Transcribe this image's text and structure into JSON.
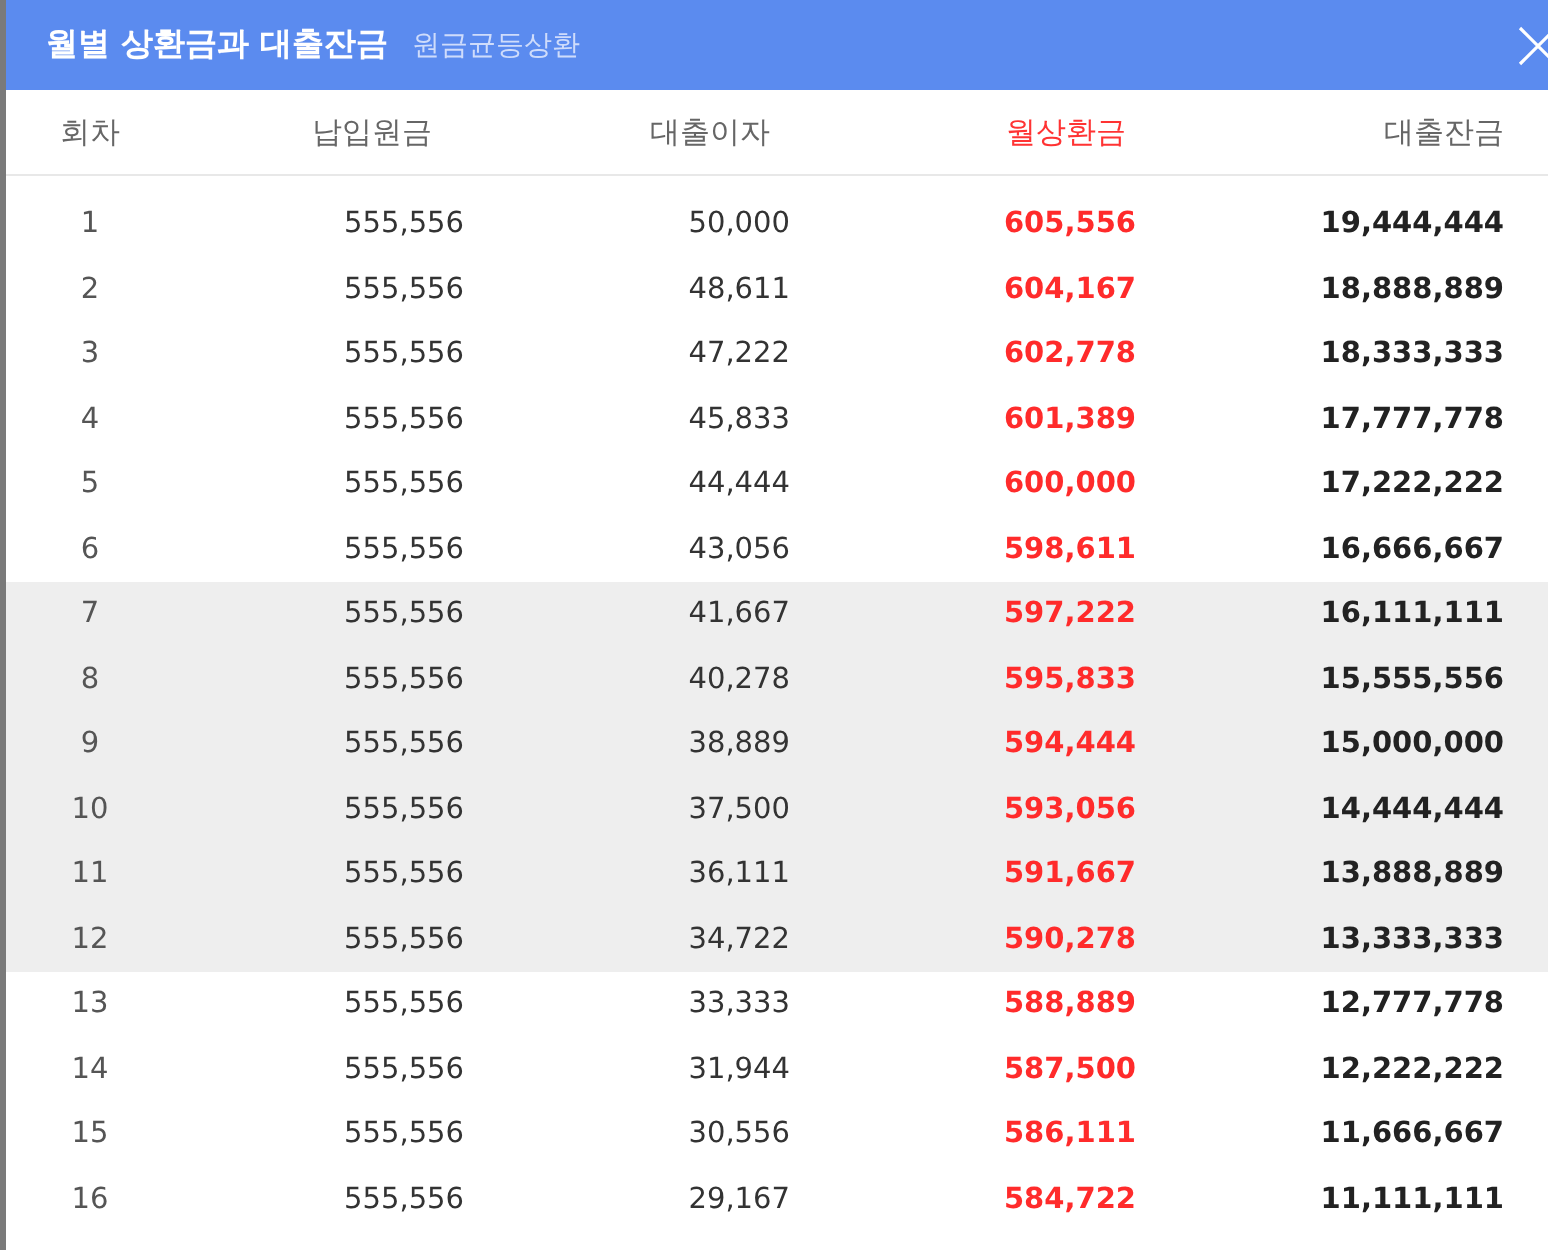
{
  "window": {
    "title": "월별 상환금과 대출잔금",
    "subtitle": "원금균등상환"
  },
  "table": {
    "columns": [
      {
        "label": "회차",
        "highlight": false
      },
      {
        "label": "납입원금",
        "highlight": false
      },
      {
        "label": "대출이자",
        "highlight": false
      },
      {
        "label": "월상환금",
        "highlight": true
      },
      {
        "label": "대출잔금",
        "highlight": false
      }
    ],
    "rows": [
      {
        "cells": [
          "1",
          "555,556",
          "50,000",
          "605,556",
          "19,444,444"
        ],
        "shaded": false
      },
      {
        "cells": [
          "2",
          "555,556",
          "48,611",
          "604,167",
          "18,888,889"
        ],
        "shaded": false
      },
      {
        "cells": [
          "3",
          "555,556",
          "47,222",
          "602,778",
          "18,333,333"
        ],
        "shaded": false
      },
      {
        "cells": [
          "4",
          "555,556",
          "45,833",
          "601,389",
          "17,777,778"
        ],
        "shaded": false
      },
      {
        "cells": [
          "5",
          "555,556",
          "44,444",
          "600,000",
          "17,222,222"
        ],
        "shaded": false
      },
      {
        "cells": [
          "6",
          "555,556",
          "43,056",
          "598,611",
          "16,666,667"
        ],
        "shaded": false
      },
      {
        "cells": [
          "7",
          "555,556",
          "41,667",
          "597,222",
          "16,111,111"
        ],
        "shaded": true
      },
      {
        "cells": [
          "8",
          "555,556",
          "40,278",
          "595,833",
          "15,555,556"
        ],
        "shaded": true
      },
      {
        "cells": [
          "9",
          "555,556",
          "38,889",
          "594,444",
          "15,000,000"
        ],
        "shaded": true
      },
      {
        "cells": [
          "10",
          "555,556",
          "37,500",
          "593,056",
          "14,444,444"
        ],
        "shaded": true
      },
      {
        "cells": [
          "11",
          "555,556",
          "36,111",
          "591,667",
          "13,888,889"
        ],
        "shaded": true
      },
      {
        "cells": [
          "12",
          "555,556",
          "34,722",
          "590,278",
          "13,333,333"
        ],
        "shaded": true
      },
      {
        "cells": [
          "13",
          "555,556",
          "33,333",
          "588,889",
          "12,777,778"
        ],
        "shaded": false
      },
      {
        "cells": [
          "14",
          "555,556",
          "31,944",
          "587,500",
          "12,222,222"
        ],
        "shaded": false
      },
      {
        "cells": [
          "15",
          "555,556",
          "30,556",
          "586,111",
          "11,666,667"
        ],
        "shaded": false
      },
      {
        "cells": [
          "16",
          "555,556",
          "29,167",
          "584,722",
          "11,111,111"
        ],
        "shaded": false
      }
    ]
  }
}
